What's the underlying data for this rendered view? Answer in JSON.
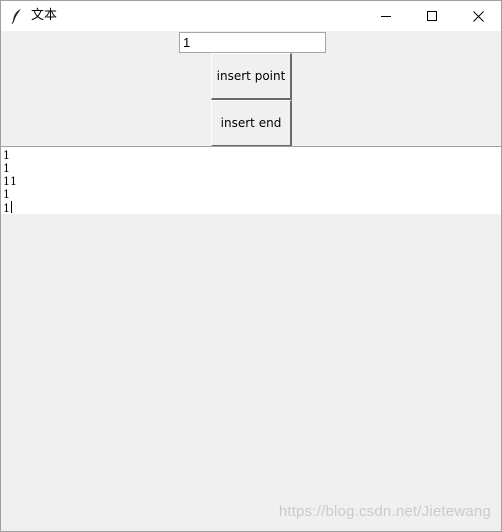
{
  "window": {
    "title": "文本",
    "icon": "feather-icon",
    "controls": {
      "minimize": "minimize-icon",
      "maximize": "maximize-icon",
      "close": "close-icon"
    }
  },
  "entry": {
    "value": "1"
  },
  "buttons": {
    "insert_point": "insert point",
    "insert_end": "insert end"
  },
  "text": {
    "lines": [
      "1",
      "1",
      "11",
      "1",
      "1"
    ]
  },
  "watermark": "https://blog.csdn.net/Jietewang",
  "colors": {
    "window_bg": "#f0f0f0",
    "text_bg": "#ffffff",
    "titlebar_bg": "#ffffff"
  }
}
